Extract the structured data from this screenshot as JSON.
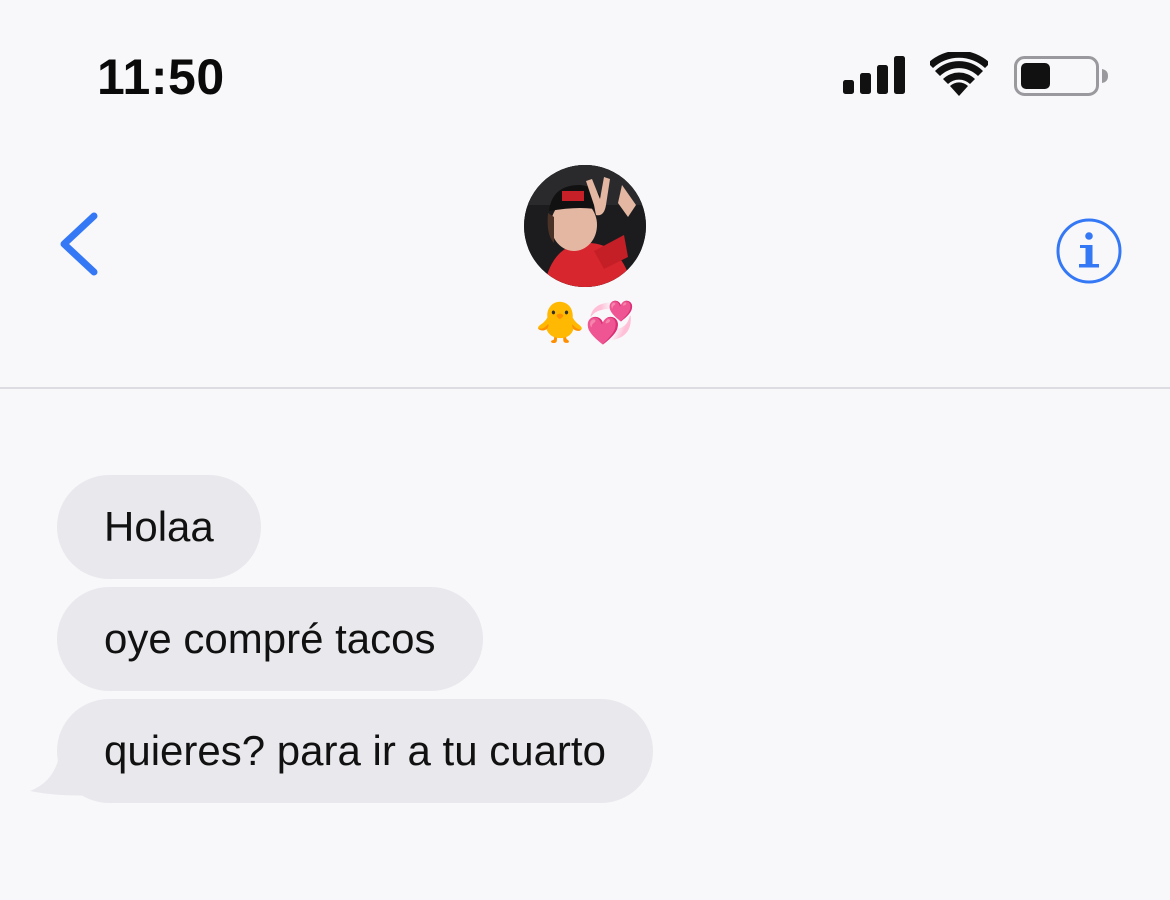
{
  "status_bar": {
    "time": "11:50",
    "signal_icon": "cellular-signal-icon",
    "wifi_icon": "wifi-icon",
    "battery_icon": "battery-icon",
    "battery_level": 0.4
  },
  "header": {
    "back_icon": "chevron-left-icon",
    "info_icon": "info-icon",
    "contact_name": "🐥💞",
    "accent_color": "#3478f6"
  },
  "messages": [
    {
      "text": "Holaa",
      "direction": "incoming"
    },
    {
      "text": "oye compré tacos",
      "direction": "incoming"
    },
    {
      "text": "quieres? para ir a tu cuarto",
      "direction": "incoming"
    }
  ],
  "colors": {
    "background": "#f8f8fa",
    "incoming_bubble": "#e8e8ed",
    "divider": "#dcdce2"
  }
}
